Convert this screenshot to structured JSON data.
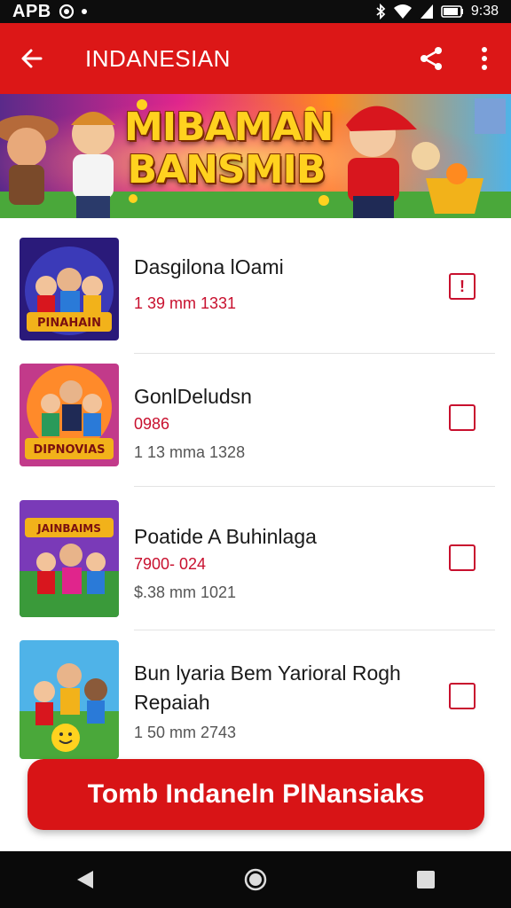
{
  "status_bar": {
    "left_text": "APB",
    "time": "9:38"
  },
  "app_bar": {
    "title": "INDANESIAN",
    "back_icon": "arrow-left-icon",
    "share_icon": "share-icon",
    "more_icon": "more-vert-icon"
  },
  "banner": {
    "line1": "MIBAMAN",
    "line2": "BANSMIB"
  },
  "items": [
    {
      "name": "Dasgilona lOami",
      "price": "",
      "sub": "1 39 mm 1331",
      "check_mark": "!"
    },
    {
      "name": "GonlDeludsn",
      "price": "0986",
      "sub": "1 13 mma 1328",
      "check_mark": ""
    },
    {
      "name": "Poatide A Buhinlaga",
      "price": "7900- 024",
      "sub": "$.38 mm 1021",
      "check_mark": ""
    },
    {
      "name": "Bun lyaria Bem Yarioral Rogh",
      "name2": "Repaiah",
      "price": "",
      "sub": "1 50 mm 2743",
      "check_mark": ""
    }
  ],
  "thumb_titles": [
    "PINAHAIN",
    "DIPNOVIAS",
    "JAINBAIMS",
    ""
  ],
  "cta_label": "Tomb Indaneln PlNansiaks",
  "colors": {
    "primary": "#dc1717",
    "accent_text": "#c8102e",
    "banner_gold": "#ffd21f"
  }
}
